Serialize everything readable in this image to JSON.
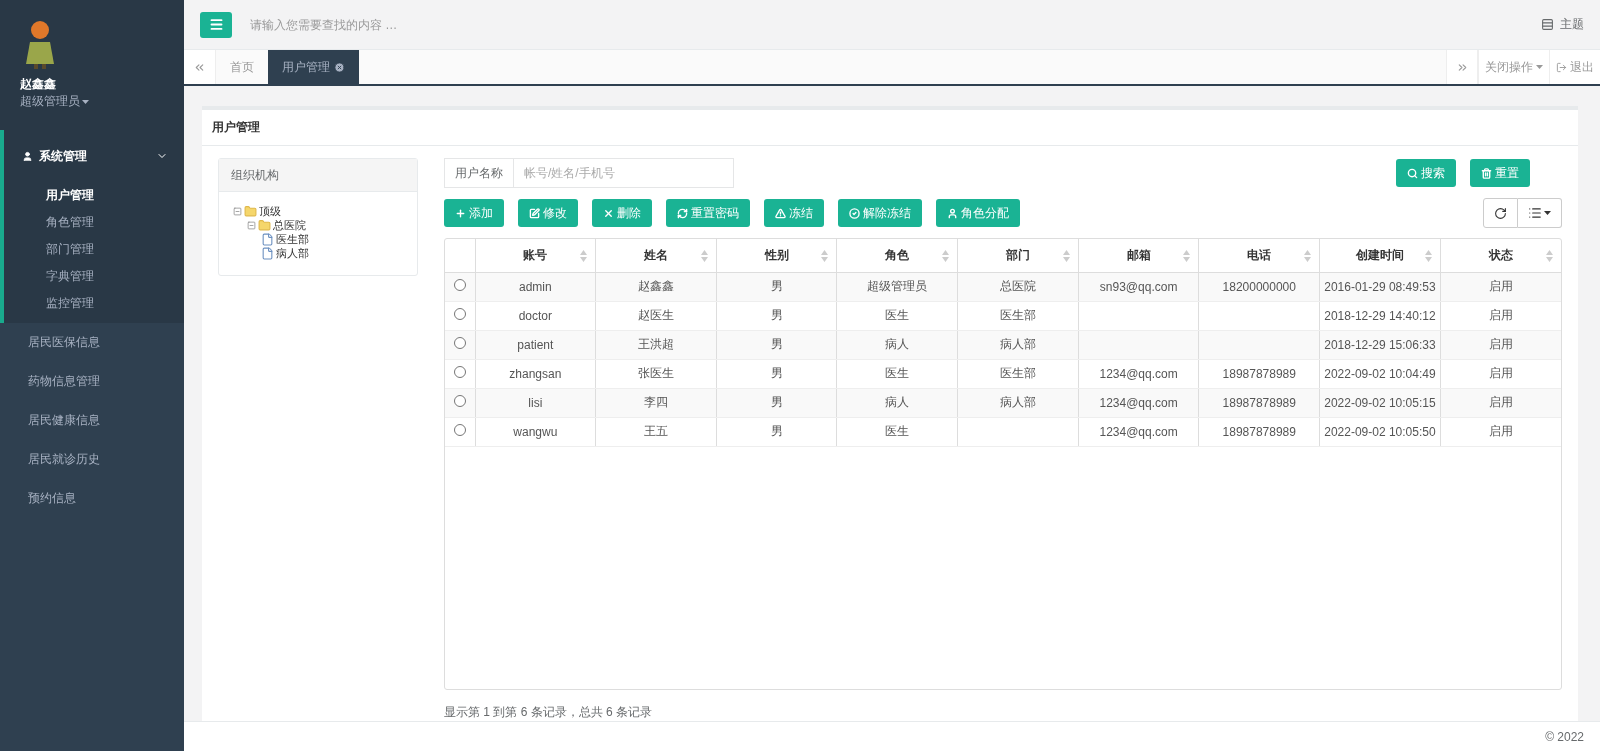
{
  "user": {
    "name": "赵鑫鑫",
    "role": "超级管理员"
  },
  "sidebar": {
    "items": [
      {
        "label": "系统管理",
        "expanded": true,
        "children": [
          {
            "label": "用户管理",
            "selected": true
          },
          {
            "label": "角色管理",
            "selected": false
          },
          {
            "label": "部门管理",
            "selected": false
          },
          {
            "label": "字典管理",
            "selected": false
          },
          {
            "label": "监控管理",
            "selected": false
          }
        ]
      },
      {
        "label": "居民医保信息",
        "expanded": false
      },
      {
        "label": "药物信息管理",
        "expanded": false
      },
      {
        "label": "居民健康信息",
        "expanded": false
      },
      {
        "label": "居民就诊历史",
        "expanded": false
      },
      {
        "label": "预约信息",
        "expanded": false
      }
    ]
  },
  "search": {
    "placeholder": "请输入您需要查找的内容 …"
  },
  "theme": "主题",
  "tabs": [
    {
      "label": "首页",
      "selected": false
    },
    {
      "label": "用户管理",
      "selected": true
    }
  ],
  "tab_actions": {
    "close_menu": "关闭操作",
    "logout": "退出"
  },
  "panel_title": "用户管理",
  "org_tree": {
    "title": "组织机构",
    "nodes": [
      {
        "label": "顶级",
        "kind": "folder",
        "expanded": true,
        "children": [
          {
            "label": "总医院",
            "kind": "folder",
            "expanded": true,
            "children": [
              {
                "label": "医生部",
                "kind": "file"
              },
              {
                "label": "病人部",
                "kind": "file"
              }
            ]
          }
        ]
      }
    ]
  },
  "filter": {
    "label": "用户名称",
    "placeholder": "帐号/姓名/手机号"
  },
  "search_buttons": [
    {
      "label": "搜索",
      "kind": "search"
    },
    {
      "label": "重置",
      "kind": "reset"
    }
  ],
  "toolbar": [
    {
      "label": "添加",
      "kind": "add"
    },
    {
      "label": "修改",
      "kind": "edit"
    },
    {
      "label": "删除",
      "kind": "delete"
    },
    {
      "label": "重置密码",
      "kind": "refresh"
    },
    {
      "label": "冻结",
      "kind": "warning"
    },
    {
      "label": "解除冻结",
      "kind": "check"
    },
    {
      "label": "角色分配",
      "kind": "user"
    }
  ],
  "table": {
    "columns": [
      "账号",
      "姓名",
      "性别",
      "角色",
      "部门",
      "邮箱",
      "电话",
      "创建时间",
      "状态"
    ],
    "rows": [
      {
        "selected": false,
        "cells": [
          "admin",
          "赵鑫鑫",
          "男",
          "超级管理员",
          "总医院",
          "sn93@qq.com",
          "18200000000",
          "2016-01-29 08:49:53",
          "启用"
        ]
      },
      {
        "selected": false,
        "cells": [
          "doctor",
          "赵医生",
          "男",
          "医生",
          "医生部",
          "",
          "",
          "2018-12-29 14:40:12",
          "启用"
        ]
      },
      {
        "selected": false,
        "cells": [
          "patient",
          "王洪超",
          "男",
          "病人",
          "病人部",
          "",
          "",
          "2018-12-29 15:06:33",
          "启用"
        ]
      },
      {
        "selected": false,
        "cells": [
          "zhangsan",
          "张医生",
          "男",
          "医生",
          "医生部",
          "1234@qq.com",
          "18987878989",
          "2022-09-02 10:04:49",
          "启用"
        ]
      },
      {
        "selected": false,
        "cells": [
          "lisi",
          "李四",
          "男",
          "病人",
          "病人部",
          "1234@qq.com",
          "18987878989",
          "2022-09-02 10:05:15",
          "启用"
        ]
      },
      {
        "selected": false,
        "cells": [
          "wangwu",
          "王五",
          "男",
          "医生",
          "",
          "1234@qq.com",
          "18987878989",
          "2022-09-02 10:05:50",
          "启用"
        ]
      }
    ]
  },
  "pagination_info": "显示第 1 到第 6 条记录，总共 6 条记录",
  "footer": "© 2022"
}
